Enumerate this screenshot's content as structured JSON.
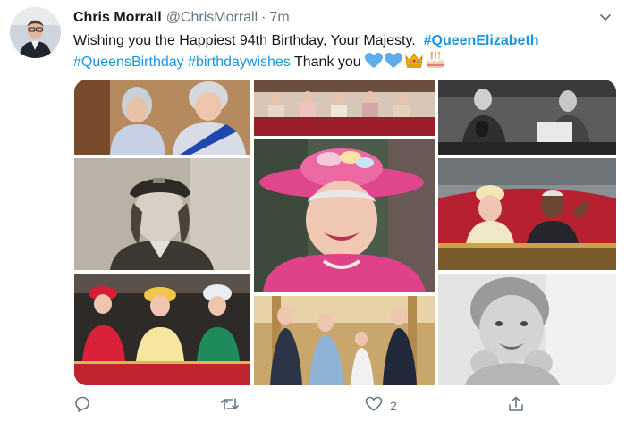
{
  "author": {
    "name": "Chris Morrall",
    "handle": "@ChrisMorrall",
    "separator": "·",
    "time": "7m"
  },
  "tweet": {
    "text_main": "Wishing you the Happiest 94th Birthday, Your Majesty.",
    "hashtag_1": "#QueenElizabeth",
    "hashtag_2": "#QueensBirthday",
    "hashtag_3": "#birthdaywishes",
    "text_end": "Thank you"
  },
  "emojis": [
    "blue-heart-icon",
    "blue-heart-icon",
    "crown-icon",
    "birthday-cake-icon"
  ],
  "actions": {
    "reply_count": "",
    "retweet_count": "",
    "like_count": "2",
    "share_count": ""
  },
  "colors": {
    "hashtag": "#1b95e0",
    "text": "#14171a",
    "muted": "#657786"
  }
}
